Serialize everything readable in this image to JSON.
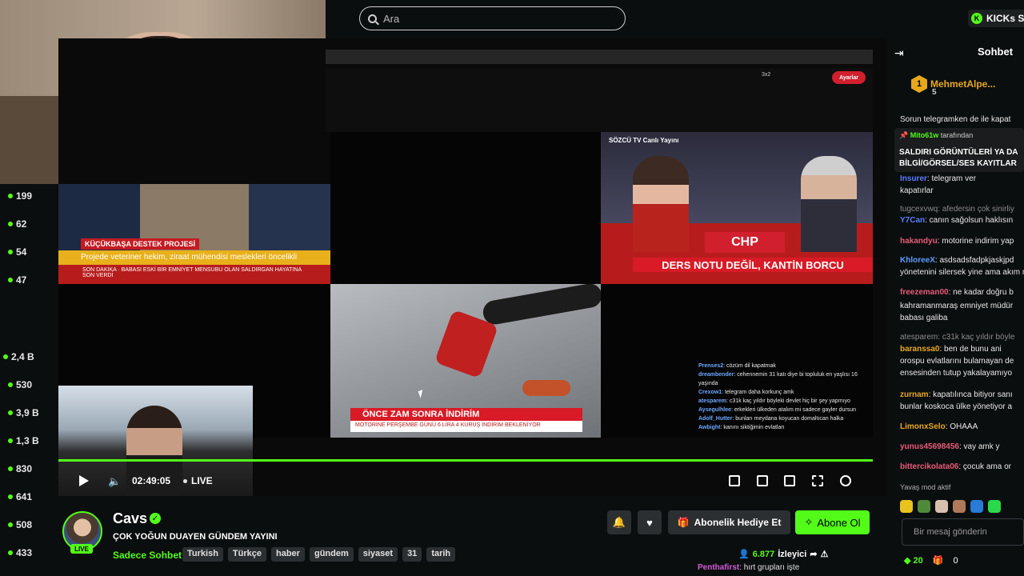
{
  "search": {
    "placeholder": "Ara"
  },
  "kicks": {
    "label": "KICKs Sa"
  },
  "sidebar_counts": [
    "199",
    "62",
    "54",
    "47",
    "2,4 B",
    "530",
    "3,9 B",
    "1,3 B",
    "830",
    "641",
    "508",
    "433"
  ],
  "tiles": {
    "a": {
      "label": "KÜÇÜKBAŞA DESTEK PROJESİ",
      "band": "Projede veteriner hekim, ziraat mühendisi meslekleri öncelikli",
      "lower": "BABASI ESKİ BİR EMNİYET MENSUBU OLAN SALDIRGAN HAYATINA SON VERDİ",
      "side": "SON DAKİKA"
    },
    "c": {
      "header": "SÖZCÜ TV Canlı Yayını",
      "logo": "CHP",
      "ticker": "DERS NOTU DEĞİL, KANTİN BORCU"
    },
    "e": {
      "head": "ÖNCE ZAM SONRA İNDİRİM",
      "sub": "MOTORİNE PERŞEMBE GÜNÜ 6 LİRA 4 KURUŞ İNDİRİM BEKLENİYOR"
    },
    "browser": {
      "ayarlar": "Ayarlar",
      "grid": "3x2"
    }
  },
  "overlay_chat": [
    {
      "user": "Prenses2",
      "text": ": cözüm dil kapatmak"
    },
    {
      "user": "dreambender",
      "text": ": cehennemin 31 katı diye bi topluluk en yaşlısı 16 yaşında"
    },
    {
      "user": "Crexow1",
      "text": ": telegram daha korkunç amk"
    },
    {
      "user": "atesparem",
      "text": ": c31k kaç yıldır böyleki devlet hiç bir şey yapmıyo"
    },
    {
      "user": "Aysegulhlee",
      "text": ": erkekleri ülkeden atalım mi sadece gayler dursun"
    },
    {
      "user": "Adolf_Hutter",
      "text": ": bunları meydana koyucan domaltıcan halka"
    },
    {
      "user": "Awbight",
      "text": ": kanını siktiğimin evlatları"
    }
  ],
  "player": {
    "time": "02:49:05",
    "live": "LIVE"
  },
  "channel": {
    "name": "Cavs",
    "title": "ÇOK YOĞUN DUAYEN GÜNDEM YAYINI",
    "category": "Sadece Sohbet",
    "tags": [
      "Turkish",
      "Türkçe",
      "haber",
      "gündem",
      "siyaset",
      "31",
      "tarih"
    ],
    "live_badge": "LIVE",
    "viewers": "6.877",
    "viewers_label": "İzleyici"
  },
  "actions": {
    "gift": "Abonelik Hediye Et",
    "subscribe": "Abone Ol"
  },
  "bottom_chat": {
    "user": "Penthafirst",
    "text": ": hırt grupları işte"
  },
  "chat": {
    "title": "Sohbet",
    "pinned_user": "MehmetAlpe...",
    "pinned_user_badge": "1",
    "pinned_user_count": "5",
    "pinned_by_user": "Mito61w",
    "pinned_by_text": "tarafından",
    "pinned_message_1": "SALDIRI GÖRÜNTÜLERİ YA DA",
    "pinned_message_2": "BİLGİ/GÖRSEL/SES KAYITLAR",
    "messages": [
      {
        "user": "",
        "text": "Sorun telegramken de ile kapat",
        "color": "#e8e8e8"
      },
      {
        "user": "Insurer",
        "text": ": telegram ver",
        "color": "#5b7cff"
      },
      {
        "user": "",
        "text": "kapatırlar",
        "color": "#e8e8e8"
      },
      {
        "user": "",
        "text": "tugcexvwq: afedersin çok sinirliy",
        "color": "#8a8a8a"
      },
      {
        "user": "Y7Can",
        "text": ": canın sağolsun haklısın",
        "color": "#5b7cff"
      },
      {
        "user": "hakandyu",
        "text": ": motorine indirim yap",
        "color": "#e85b7a"
      },
      {
        "user": "KhloreeX",
        "text": ": asdsadsfadpkjaskjpd",
        "color": "#5b9cff"
      },
      {
        "user": "",
        "text": "yönetenini silersek yine ama akım me",
        "color": "#e8e8e8"
      },
      {
        "user": "freezeman00",
        "text": ": ne kadar doğru b",
        "color": "#e85b7a"
      },
      {
        "user": "",
        "text": "kahramanmaraş emniyet müdür",
        "color": "#e8e8e8"
      },
      {
        "user": "",
        "text": "babası galiba",
        "color": "#e8e8e8"
      },
      {
        "user": "",
        "text": "atesparem: c31k kaç yıldır böyle",
        "color": "#8a8a8a"
      },
      {
        "user": "baranssa0",
        "text": ": ben de bunu ani",
        "color": "#e8a81e"
      },
      {
        "user": "",
        "text": "orospu evlatlarını bulamayan de",
        "color": "#e8e8e8"
      },
      {
        "user": "",
        "text": "ensesinden tutup yakalayamıyo",
        "color": "#e8e8e8"
      },
      {
        "user": "zurnam",
        "text": ": kapatılınca bitiyor sanı",
        "color": "#e8a81e"
      },
      {
        "user": "",
        "text": "bunlar koskoca ülke yönetiyor a",
        "color": "#e8e8e8"
      },
      {
        "user": "LimonxSelo",
        "text": ": OHAAA",
        "color": "#e8a81e"
      },
      {
        "user": "yunus45698456",
        "text": ": vay amk y",
        "color": "#e85b7a"
      },
      {
        "user": "bittercikolata06",
        "text": ": çocuk ama or",
        "color": "#e85b7a"
      }
    ],
    "slow_mode": "Yavaş mod aktif",
    "input_placeholder": "Bir mesaj gönderin",
    "points": "20",
    "zero": "0"
  }
}
